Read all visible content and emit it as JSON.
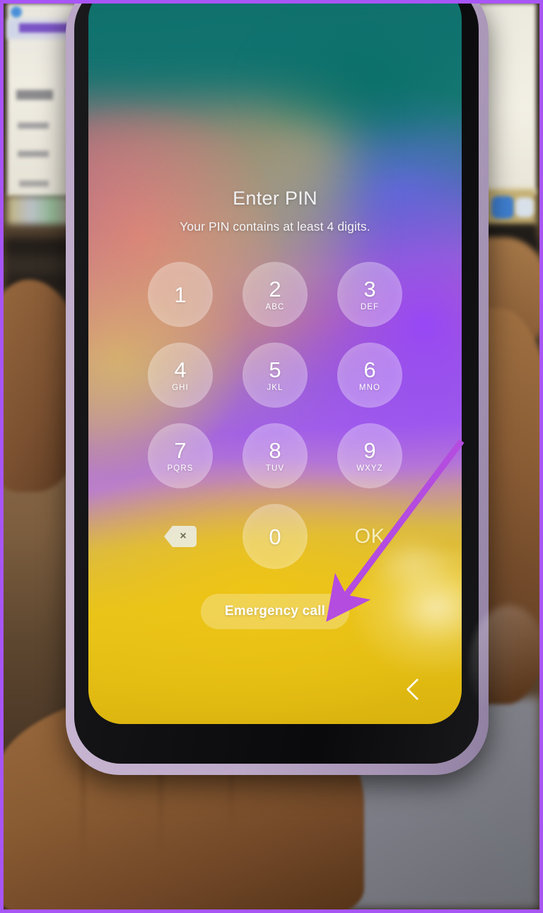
{
  "screen": {
    "title": "Enter PIN",
    "subtitle": "Your PIN contains at least 4 digits.",
    "keypad": [
      {
        "digit": "1",
        "letters": ""
      },
      {
        "digit": "2",
        "letters": "ABC"
      },
      {
        "digit": "3",
        "letters": "DEF"
      },
      {
        "digit": "4",
        "letters": "GHI"
      },
      {
        "digit": "5",
        "letters": "JKL"
      },
      {
        "digit": "6",
        "letters": "MNO"
      },
      {
        "digit": "7",
        "letters": "PQRS"
      },
      {
        "digit": "8",
        "letters": "TUV"
      },
      {
        "digit": "9",
        "letters": "WXYZ"
      },
      {
        "digit": "0",
        "letters": ""
      }
    ],
    "backspace_glyph": "×",
    "ok_label": "OK",
    "emergency_label": "Emergency call",
    "back_label": "Back"
  },
  "annotation": {
    "arrow_color": "#b44ce0",
    "border_color": "#a855f7"
  },
  "colors": {
    "phone_case": "#bda9c8",
    "bezel": "#101012",
    "wallpaper_teal": "#0f6f6b",
    "wallpaper_pink": "#e2607c",
    "wallpaper_purple": "#a15fe8",
    "wallpaper_yellow": "#e8c41a",
    "key_fill": "rgba(255,255,255,0.30)",
    "ok_text": "rgba(255,252,225,0.80)"
  }
}
